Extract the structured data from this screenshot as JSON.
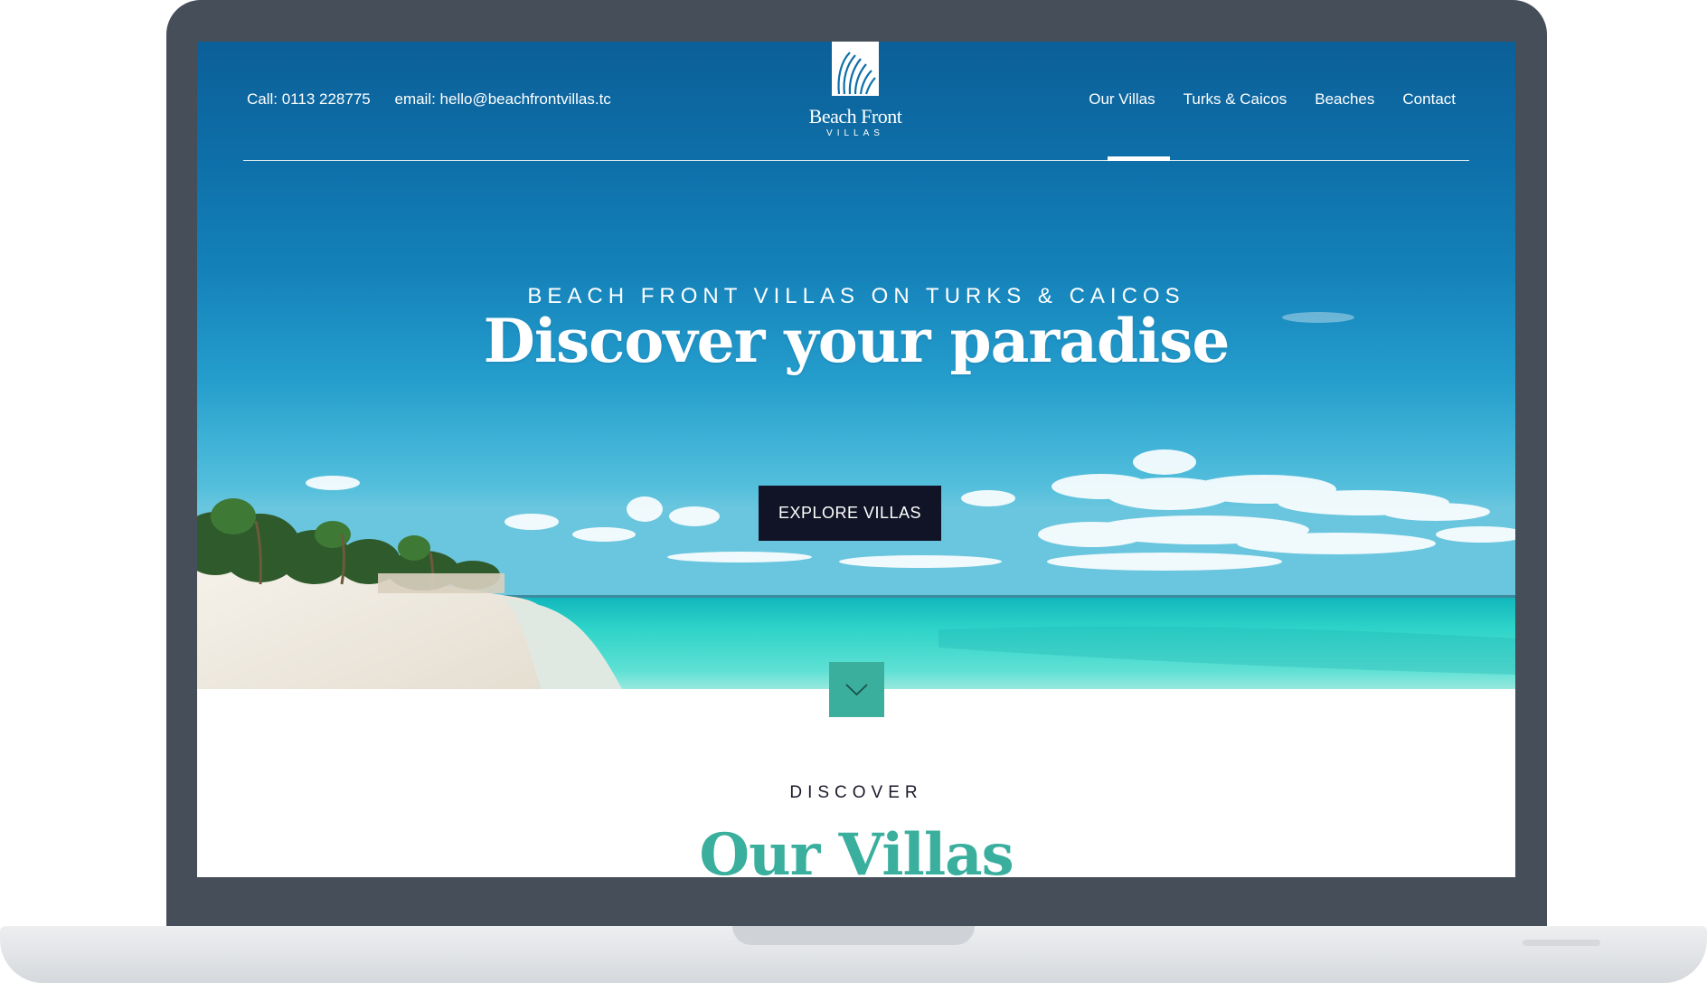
{
  "header": {
    "phone": "Call: 0113 228775",
    "email": "email: hello@beachfrontvillas.tc",
    "logo": {
      "name": "Beach Front",
      "sub": "VILLAS"
    },
    "nav": [
      {
        "label": "Our Villas",
        "active": true
      },
      {
        "label": "Turks & Caicos",
        "active": false
      },
      {
        "label": "Beaches",
        "active": false
      },
      {
        "label": "Contact",
        "active": false
      }
    ]
  },
  "hero": {
    "eyebrow": "BEACH FRONT VILLAS ON TURKS & CAICOS",
    "headline": "Discover your paradise",
    "cta_label": "EXPLORE VILLAS"
  },
  "section": {
    "eyebrow": "DISCOVER",
    "title": "Our Villas"
  },
  "colors": {
    "accent": "#3aaf9e",
    "cta": "#111426",
    "frame": "#464e59",
    "sky": "#0e6fa8",
    "sea": "#2fd4c9"
  },
  "icons": {
    "scroll": "chevron-down-icon",
    "logo": "shell-icon"
  }
}
